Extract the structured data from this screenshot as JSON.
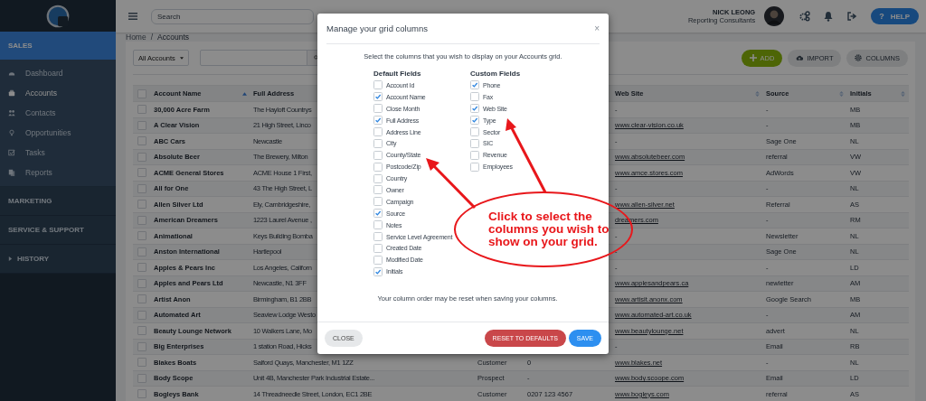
{
  "sidebar": {
    "section": {
      "label": "SALES",
      "selected": true
    },
    "items": [
      {
        "label": "Dashboard",
        "selected": false
      },
      {
        "label": "Accounts",
        "selected": true
      },
      {
        "label": "Contacts",
        "selected": false
      },
      {
        "label": "Opportunities",
        "selected": false
      },
      {
        "label": "Tasks",
        "selected": false
      },
      {
        "label": "Reports",
        "selected": false
      }
    ],
    "sections": [
      {
        "label": "MARKETING"
      },
      {
        "label": "SERVICE & SUPPORT"
      },
      {
        "label": "HISTORY",
        "expanded": false
      }
    ]
  },
  "topbar": {
    "search": {
      "placeholder": "Search"
    },
    "user": {
      "name": "NICK LEONG",
      "company": "Reporting Consultants"
    },
    "help": {
      "glyph": "?",
      "label": "HELP"
    }
  },
  "breadcrumb": {
    "items": [
      "Home",
      "Accounts"
    ],
    "separator": "/"
  },
  "toolbar": {
    "view": "All Accounts",
    "buttons": [
      {
        "label": "ADD",
        "kind": "primary"
      },
      {
        "label": "IMPORT",
        "kind": "plain"
      },
      {
        "label": "COLUMNS",
        "kind": "plain"
      }
    ]
  },
  "table": {
    "header": {
      "checked": false,
      "account_name": {
        "label": "Account Name",
        "sorted": true
      },
      "full_address": {
        "label": "Full Address"
      },
      "web_site": {
        "label": "Web Site",
        "sorted": false
      },
      "source": {
        "label": "Source",
        "sorted": false
      },
      "initials": {
        "label": "Initials",
        "sorted": false
      }
    },
    "rows": [
      {
        "checked": false,
        "account_name": "30,000 Acre Farm",
        "full_address": "The Hayloft Countrys",
        "web_site": {
          "text": "-",
          "link": false
        },
        "source": "-",
        "initials": "MB"
      },
      {
        "checked": false,
        "account_name": "A Clear Vision",
        "full_address": "21 High Street, Linco",
        "web_site": {
          "text": "www.clear-vision.co.uk",
          "link": true
        },
        "source": "-",
        "initials": "MB"
      },
      {
        "checked": false,
        "account_name": "ABC Cars",
        "full_address": "Newcastle",
        "web_site": {
          "text": "-",
          "link": false
        },
        "source": "Sage One",
        "initials": "NL"
      },
      {
        "checked": false,
        "account_name": "Absolute Beer",
        "full_address": "The Brewery, Milton",
        "web_site": {
          "text": "www.absolutebeer.com",
          "link": true
        },
        "source": "referral",
        "initials": "VW"
      },
      {
        "checked": false,
        "account_name": "ACME General Stores",
        "full_address": "ACME House 1 First,",
        "web_site": {
          "text": "www.amce.stores.com",
          "link": true
        },
        "source": "AdWords",
        "initials": "VW"
      },
      {
        "checked": false,
        "account_name": "All for One",
        "full_address": "43 The High Street, L",
        "web_site": {
          "text": "-",
          "link": false
        },
        "source": "-",
        "initials": "NL"
      },
      {
        "checked": false,
        "account_name": "Allen Silver Ltd",
        "full_address": "Ely, Cambridgeshire,",
        "web_site": {
          "text": "www.allen-silver.net",
          "link": true
        },
        "source": "Referral",
        "initials": "AS"
      },
      {
        "checked": false,
        "account_name": "American Dreamers",
        "full_address": "1223 Laurel Avenue ,",
        "web_site": {
          "text": "dreamers.com",
          "link": true
        },
        "source": "-",
        "initials": "RM"
      },
      {
        "checked": false,
        "account_name": "Animational",
        "full_address": "Keys Building Bomba",
        "web_site": {
          "text": "-",
          "link": false
        },
        "source": "Newsletter",
        "initials": "NL"
      },
      {
        "checked": false,
        "account_name": "Anston International",
        "full_address": "Hartlepool",
        "web_site": {
          "text": "-",
          "link": false
        },
        "source": "Sage One",
        "initials": "NL"
      },
      {
        "checked": false,
        "account_name": "Apples & Pears Inc",
        "full_address": "Los Angeles, Californ",
        "web_site": {
          "text": "-",
          "link": false
        },
        "source": "-",
        "initials": "LD"
      },
      {
        "checked": false,
        "account_name": "Apples and Pears Ltd",
        "full_address": "Newcastle, N1 3FF",
        "web_site": {
          "text": "www.applesandpears.ca",
          "link": true
        },
        "source": "newletter",
        "initials": "AM"
      },
      {
        "checked": false,
        "account_name": "Artist Anon",
        "full_address": "Birmingham, B1 2BB",
        "web_site": {
          "text": "www.artisit.anonx.com",
          "link": true
        },
        "source": "Google Search",
        "initials": "MB"
      },
      {
        "checked": false,
        "account_name": "Automated Art",
        "full_address": "Seaview Lodge Westo",
        "web_site": {
          "text": "www.automated-art.co.uk",
          "link": true
        },
        "source": "-",
        "initials": "AM"
      },
      {
        "checked": false,
        "account_name": "Beauty Lounge Network",
        "full_address": "10 Walkers Lane, Mo",
        "web_site": {
          "text": "www.beautylounge.net",
          "link": true
        },
        "source": "advert",
        "initials": "NL"
      },
      {
        "checked": false,
        "account_name": "Big Enterprises",
        "full_address": "1 station Road, Hicks",
        "web_site": {
          "text": "-",
          "link": false
        },
        "source": "Email",
        "initials": "RB"
      },
      {
        "checked": false,
        "account_name": "Blakes Boats",
        "full_address": "Salford Quays, Manchester, M1 1ZZ",
        "column_3": "Customer",
        "column_4": "0",
        "web_site": {
          "text": "www.blakes.net",
          "link": true
        },
        "source": "-",
        "initials": "NL"
      },
      {
        "checked": false,
        "account_name": "Body Scope",
        "full_address": "Unit 4B, Manchester Park Industrial Estate...",
        "column_3": "Prospect",
        "column_4": "-",
        "web_site": {
          "text": "www.body.scoope.com",
          "link": true
        },
        "source": "Email",
        "initials": "LD"
      },
      {
        "checked": false,
        "account_name": "Bogleys Bank",
        "full_address": "14 Threadneedle Street, London, EC1 2BE",
        "column_3": "Customer",
        "column_4": "0207 123 4567",
        "web_site": {
          "text": "www.bogleys.com",
          "link": true
        },
        "source": "referral",
        "initials": "AS"
      }
    ]
  },
  "modal": {
    "title": "Manage your grid columns",
    "close": "×",
    "intro": "Select the columns that you wish to display on your Accounts grid.",
    "groups": [
      {
        "title": "Default Fields",
        "fields": [
          {
            "label": "Account Id",
            "checked": false
          },
          {
            "label": "Account Name",
            "checked": true
          },
          {
            "label": "Close Month",
            "checked": false
          },
          {
            "label": "Full Address",
            "checked": true
          },
          {
            "label": "Address Line",
            "checked": false
          },
          {
            "label": "City",
            "checked": false
          },
          {
            "label": "County/State",
            "checked": false
          },
          {
            "label": "Postcode/Zip",
            "checked": false
          },
          {
            "label": "Country",
            "checked": false
          },
          {
            "label": "Owner",
            "checked": false
          },
          {
            "label": "Campaign",
            "checked": false
          },
          {
            "label": "Source",
            "checked": true
          },
          {
            "label": "Notes",
            "checked": false
          },
          {
            "label": "Service Level Agreement",
            "checked": false
          },
          {
            "label": "Created Date",
            "checked": false
          },
          {
            "label": "Modified Date",
            "checked": false
          },
          {
            "label": "Initials",
            "checked": true
          }
        ]
      },
      {
        "title": "Custom Fields",
        "fields": [
          {
            "label": "Phone",
            "checked": true
          },
          {
            "label": "Fax",
            "checked": false
          },
          {
            "label": "Web Site",
            "checked": true
          },
          {
            "label": "Type",
            "checked": true
          },
          {
            "label": "Sector",
            "checked": false
          },
          {
            "label": "SIC",
            "checked": false
          },
          {
            "label": "Revenue",
            "checked": false
          },
          {
            "label": "Employees",
            "checked": false
          }
        ]
      }
    ],
    "note": "Your column order may be reset when saving your columns.",
    "buttons": [
      {
        "label": "CLOSE",
        "kind": "close"
      },
      {
        "label": "RESET TO DEFAULTS",
        "kind": "danger"
      },
      {
        "label": "SAVE",
        "kind": "primary"
      }
    ]
  },
  "callout": {
    "text": "Click to select the columns you wish to show on your grid."
  }
}
